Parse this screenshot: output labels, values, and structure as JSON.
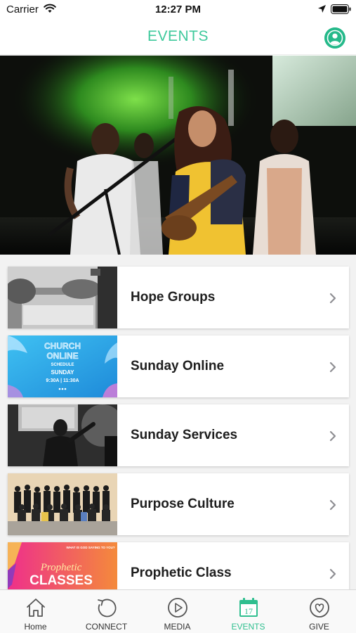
{
  "status_bar": {
    "carrier": "Carrier",
    "time": "12:27 PM"
  },
  "header": {
    "title": "EVENTS",
    "accent_color": "#3ec99c"
  },
  "events": [
    {
      "label": "Hope Groups",
      "thumbnail": "people-at-table-photo"
    },
    {
      "label": "Sunday Online",
      "thumbnail": "church-online-schedule-graphic",
      "graphic_text": {
        "line1": "CHURCH",
        "line2": "ONLINE",
        "line3": "SCHEDULE",
        "line4": "SUNDAY",
        "line5": "9:30A  |  11:30A"
      }
    },
    {
      "label": "Sunday Services",
      "thumbnail": "worship-stage-photo"
    },
    {
      "label": "Purpose Culture",
      "thumbnail": "group-photo"
    },
    {
      "label": "Prophetic Class",
      "thumbnail": "prophetic-classes-graphic",
      "graphic_text": {
        "tagline": "WHAT IS GOD SAYING TO YOU?",
        "line1": "Prophetic",
        "line2": "CLASSES"
      }
    }
  ],
  "tabs": [
    {
      "label": "Home",
      "icon": "home-icon",
      "active": false
    },
    {
      "label": "CONNECT",
      "icon": "refresh-icon",
      "active": false
    },
    {
      "label": "MEDIA",
      "icon": "play-icon",
      "active": false
    },
    {
      "label": "EVENTS",
      "icon": "calendar-icon",
      "active": true,
      "calendar_day": "17"
    },
    {
      "label": "GIVE",
      "icon": "heart-icon",
      "active": false
    }
  ]
}
